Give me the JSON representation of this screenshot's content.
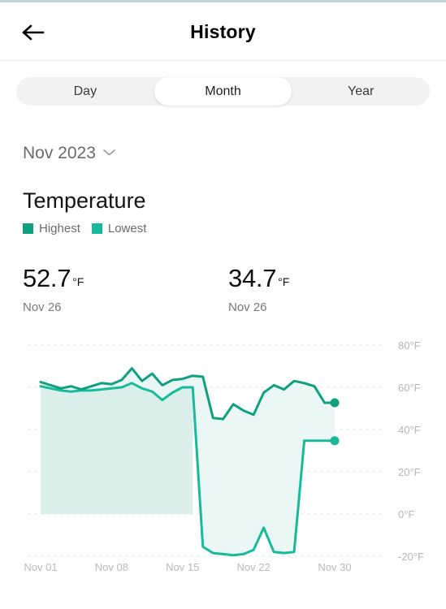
{
  "header": {
    "title": "History",
    "back_icon": "arrow-left-icon"
  },
  "segmented": {
    "options": [
      "Day",
      "Month",
      "Year"
    ],
    "selected": "Month"
  },
  "period": {
    "label": "Nov 2023",
    "chevron_icon": "chevron-down-icon"
  },
  "metric": {
    "title": "Temperature"
  },
  "legend": [
    {
      "label": "Highest",
      "color": "#0fa080"
    },
    {
      "label": "Lowest",
      "color": "#17bb9c"
    }
  ],
  "stats": [
    {
      "value": "52.7",
      "unit": "°F",
      "date": "Nov 26"
    },
    {
      "value": "34.7",
      "unit": "°F",
      "date": "Nov 26"
    }
  ],
  "colors": {
    "line": "#0fa884",
    "fill_solid": "#daefea",
    "fill_band": "#eaf7f4",
    "grid": "#e6e6e6",
    "accent_strip": "#bcd9da"
  },
  "chart_data": {
    "type": "line",
    "title": "Temperature",
    "xlabel": "",
    "ylabel": "°F",
    "ylim": [
      -20,
      80
    ],
    "yticks": [
      80,
      60,
      40,
      20,
      0,
      -20
    ],
    "ytick_labels": [
      "80°F",
      "60°F",
      "40°F",
      "20°F",
      "0°F",
      "-20°F"
    ],
    "xticks": [
      1,
      8,
      15,
      22,
      30
    ],
    "xtick_labels": [
      "Nov 01",
      "Nov 08",
      "Nov 15",
      "Nov 22",
      "Nov 30"
    ],
    "grid": true,
    "legend_position": "top-left",
    "x": [
      1,
      2,
      3,
      4,
      5,
      6,
      7,
      8,
      9,
      10,
      11,
      12,
      13,
      14,
      15,
      16,
      17,
      18,
      19,
      20,
      21,
      22,
      23,
      24,
      25,
      26,
      27,
      28,
      29,
      30
    ],
    "series": [
      {
        "name": "Highest",
        "color": "#0fa080",
        "values": [
          62.5,
          61.0,
          59.5,
          60.5,
          59.0,
          60.5,
          62.0,
          61.5,
          63.5,
          69.0,
          63.0,
          66.5,
          61.0,
          63.5,
          64.0,
          65.5,
          65.0,
          45.5,
          45.0,
          52.0,
          49.0,
          47.0,
          57.5,
          61.0,
          59.0,
          63.0,
          62.0,
          60.5,
          52.7,
          52.7
        ],
        "end_marker": true,
        "end_value": 52.7
      },
      {
        "name": "Lowest",
        "color": "#17bb9c",
        "values": [
          60.5,
          59.5,
          58.5,
          58.0,
          58.5,
          58.5,
          59.0,
          59.5,
          60.0,
          62.0,
          59.5,
          58.0,
          54.0,
          57.5,
          60.0,
          60.0,
          -15.5,
          -18.5,
          -19.0,
          -19.5,
          -19.0,
          -17.0,
          -6.5,
          -18.0,
          -18.5,
          -18.0,
          34.7,
          34.7,
          34.7,
          34.7
        ],
        "end_marker": true,
        "end_value": 34.7
      }
    ],
    "baseline": 0,
    "annotations": [
      {
        "text": "Highest 52.7°F on Nov 26"
      },
      {
        "text": "Lowest 34.7°F on Nov 26"
      }
    ]
  }
}
